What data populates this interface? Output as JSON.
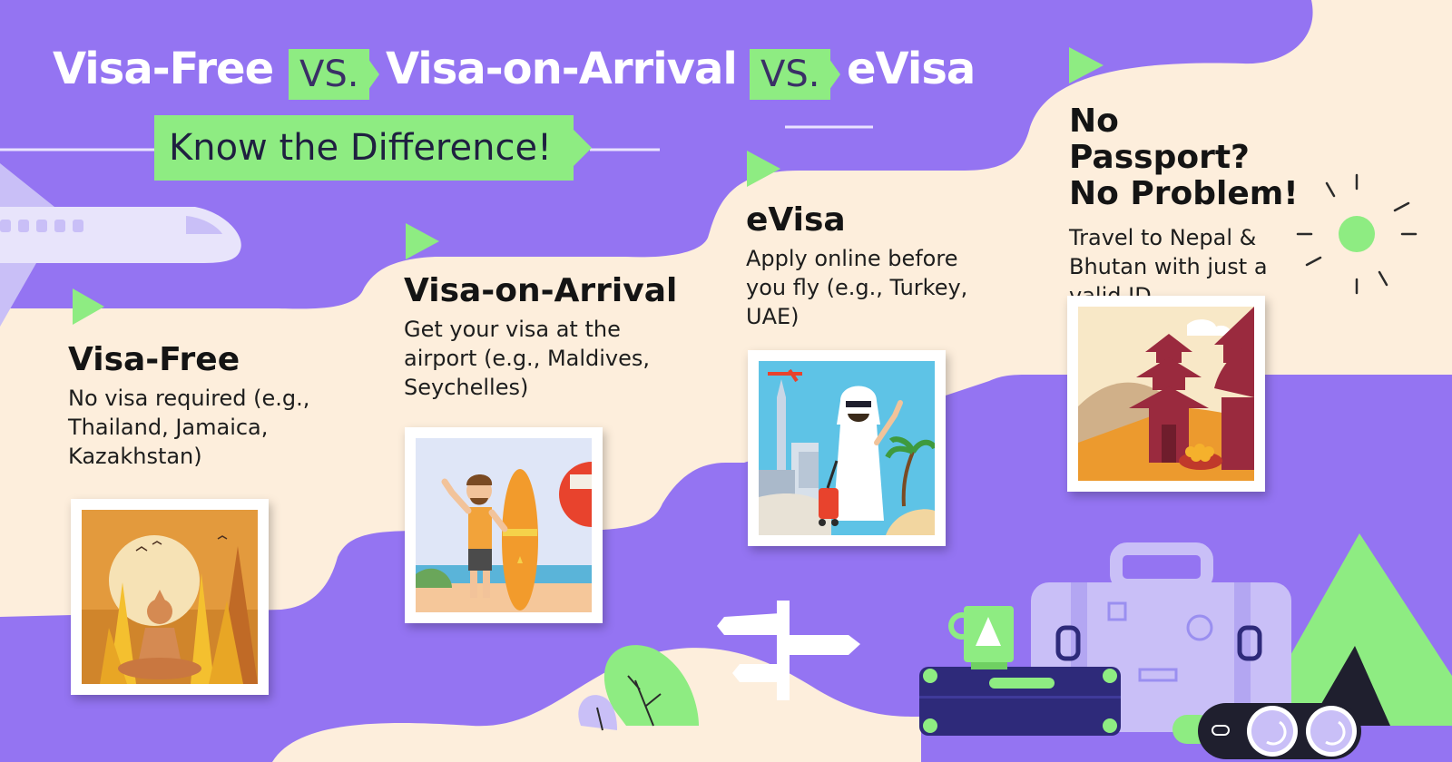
{
  "header": {
    "title_part1": "Visa-Free",
    "vs_label": "VS.",
    "title_part2": "Visa-on-Arrival",
    "title_part3": "eVisa",
    "subtitle": "Know the Difference!"
  },
  "sections": [
    {
      "title": "Visa-Free",
      "description": "No visa required (e.g., Thailand, Jamaica, Kazakhstan)",
      "illustration": "thai-temple-buddha"
    },
    {
      "title": "Visa-on-Arrival",
      "description": "Get your visa at the airport (e.g., Maldives, Seychelles)",
      "illustration": "beach-surfer"
    },
    {
      "title": "eVisa",
      "description": "Apply online before you fly (e.g., Turkey, UAE)",
      "illustration": "traveler-city"
    },
    {
      "title": "No Passport? No Problem!",
      "description": "Travel to Nepal & Bhutan with just a valid ID",
      "illustration": "nepal-pagoda"
    }
  ],
  "colors": {
    "purple": "#9474f2",
    "cream": "#fdeedc",
    "accent_green": "#8eec82",
    "dark_navy": "#2e2a7a",
    "lavender": "#c9bff7"
  },
  "decorations": [
    "airplane-icon",
    "play-arrow-icon",
    "sun-icon",
    "signpost-icon",
    "suitcase-icon",
    "tent-icon",
    "binoculars-icon",
    "plant-icon"
  ]
}
